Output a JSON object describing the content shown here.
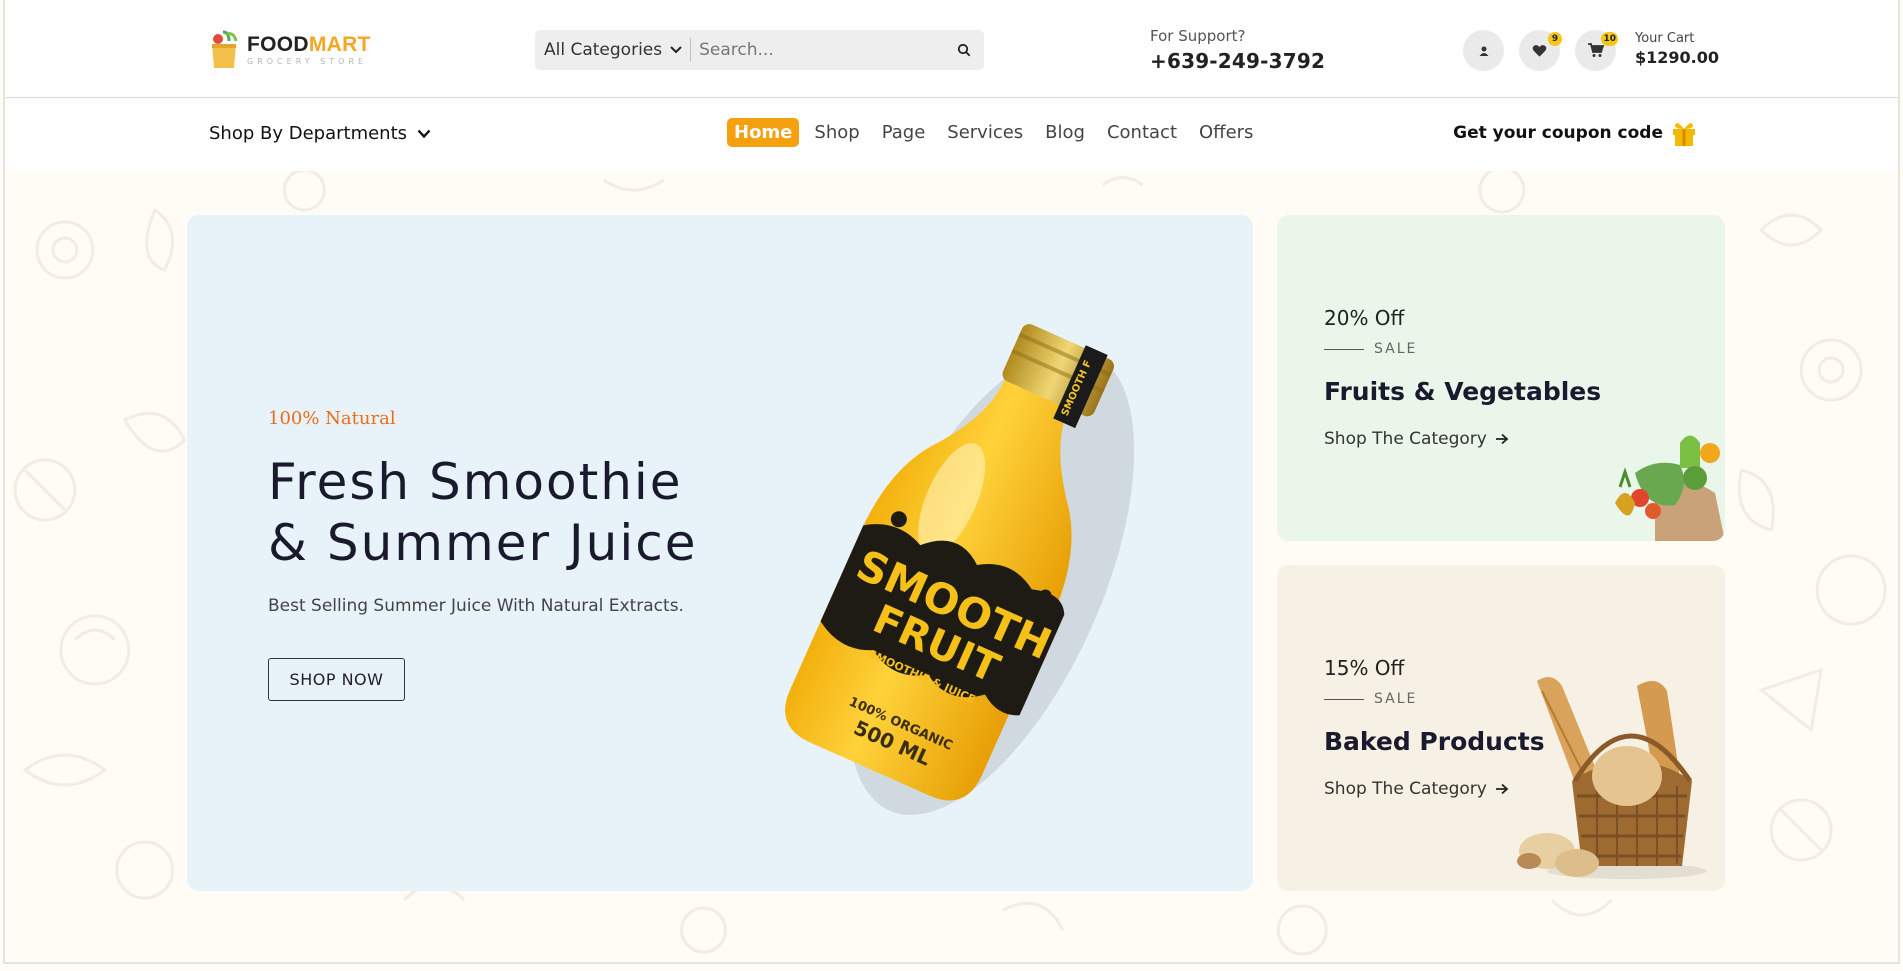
{
  "header": {
    "logo": {
      "brand_first": "FOOD",
      "brand_second": "MART",
      "tagline": "GROCERY STORE"
    },
    "search": {
      "category": "All Categories",
      "placeholder": "Search..."
    },
    "support": {
      "label": "For Support?",
      "phone": "+639-249-3792"
    },
    "wishlist_count": "9",
    "cart_count": "10",
    "cart": {
      "label": "Your Cart",
      "total": "$1290.00"
    }
  },
  "nav": {
    "departments": "Shop By Departments",
    "items": [
      "Home",
      "Shop",
      "Page",
      "Services",
      "Blog",
      "Contact",
      "Offers"
    ],
    "coupon": "Get your coupon code"
  },
  "hero": {
    "tag": "100% Natural",
    "title_line1": "Fresh Smoothie",
    "title_line2": "& Summer Juice",
    "description": "Best Selling Summer Juice With Natural Extracts.",
    "button": "SHOP NOW",
    "bottle": {
      "label_top": "SMOOTH",
      "label_bottom": "FRUIT",
      "sub": "SMOOTHIE & JUICE",
      "organic": "100% ORGANIC",
      "volume": "500 ML",
      "neck": "SMOOTH F"
    }
  },
  "promo_cards": [
    {
      "discount": "20% Off",
      "sale": "SALE",
      "title": "Fruits & Vegetables",
      "link": "Shop The Category",
      "bg": "#eaf6ea"
    },
    {
      "discount": "15% Off",
      "sale": "SALE",
      "title": "Baked Products",
      "link": "Shop The Category",
      "bg": "#f6f1e4"
    }
  ],
  "colors": {
    "accent": "#f5a00e",
    "brand_yellow": "#f5a623",
    "hero_bg": "#e8f2f9",
    "tag_orange": "#ea6d1c"
  },
  "icons": [
    "user-icon",
    "heart-icon",
    "cart-icon",
    "search-icon",
    "gift-icon",
    "chevron-down-icon",
    "arrow-right-icon"
  ]
}
